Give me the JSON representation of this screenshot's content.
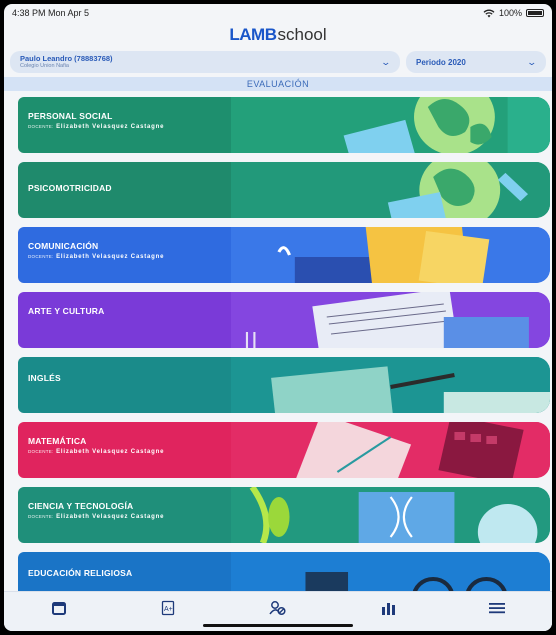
{
  "status": {
    "time": "4:38 PM  Mon Apr 5",
    "battery": "100%"
  },
  "brand": {
    "lamb": "LAMB",
    "school": "school"
  },
  "student_selector": {
    "name": "Paulo Leandro (78883768)",
    "school": "Colegio Union Nafia"
  },
  "period_selector": {
    "value": "Periodo 2020"
  },
  "section": {
    "title": "EVALUACIÓN"
  },
  "courses": [
    {
      "title": "PERSONAL SOCIAL",
      "teacher_label": "DOCENTE:",
      "teacher": "Elizabeth Velasquez Castagne",
      "color": "#1e8f6e"
    },
    {
      "title": "PSICOMOTRICIDAD",
      "teacher_label": "",
      "teacher": "",
      "color": "#1f8a6c"
    },
    {
      "title": "COMUNICACIÓN",
      "teacher_label": "DOCENTE:",
      "teacher": "Elizabeth Velasquez Castagne",
      "color": "#2f6be0"
    },
    {
      "title": "ARTE Y CULTURA",
      "teacher_label": "",
      "teacher": "",
      "color": "#7a3ad8"
    },
    {
      "title": "INGLÉS",
      "teacher_label": "",
      "teacher": "",
      "color": "#1a8b8a"
    },
    {
      "title": "MATEMÁTICA",
      "teacher_label": "DOCENTE:",
      "teacher": "Elizabeth Velasquez Castagne",
      "color": "#e0245e"
    },
    {
      "title": "CIENCIA Y TECNOLOGÍA",
      "teacher_label": "DOCENTE:",
      "teacher": "Elizabeth Velasquez Castagne",
      "color": "#1f8f7a"
    },
    {
      "title": "EDUCACIÓN RELIGIOSA",
      "teacher_label": "",
      "teacher": "",
      "color": "#1a74c6"
    }
  ],
  "tabbar": [
    "calendar-icon",
    "grades-icon",
    "students-icon",
    "stats-icon",
    "menu-icon"
  ]
}
